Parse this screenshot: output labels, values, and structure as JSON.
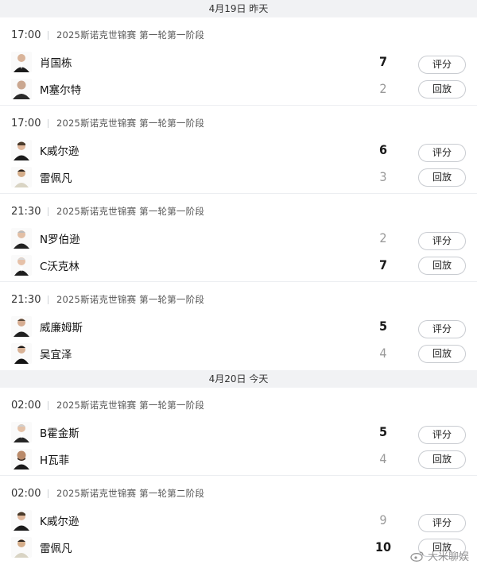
{
  "days": [
    {
      "date_label": "4月19日 昨天",
      "matches": [
        {
          "time": "17:00",
          "name": "2025斯诺克世锦赛 第一轮第一阶段",
          "p1": {
            "name": "肖国栋",
            "score": "7",
            "win": true
          },
          "p2": {
            "name": "M塞尔特",
            "score": "2",
            "win": false
          },
          "btn1": "评分",
          "btn2": "回放"
        },
        {
          "time": "17:00",
          "name": "2025斯诺克世锦赛 第一轮第一阶段",
          "p1": {
            "name": "K威尔逊",
            "score": "6",
            "win": true
          },
          "p2": {
            "name": "雷佩凡",
            "score": "3",
            "win": false
          },
          "btn1": "评分",
          "btn2": "回放"
        },
        {
          "time": "21:30",
          "name": "2025斯诺克世锦赛 第一轮第一阶段",
          "p1": {
            "name": "N罗伯逊",
            "score": "2",
            "win": false
          },
          "p2": {
            "name": "C沃克林",
            "score": "7",
            "win": true
          },
          "btn1": "评分",
          "btn2": "回放"
        },
        {
          "time": "21:30",
          "name": "2025斯诺克世锦赛 第一轮第一阶段",
          "p1": {
            "name": "威廉姆斯",
            "score": "5",
            "win": true
          },
          "p2": {
            "name": "吴宜泽",
            "score": "4",
            "win": false
          },
          "btn1": "评分",
          "btn2": "回放"
        }
      ]
    },
    {
      "date_label": "4月20日 今天",
      "matches": [
        {
          "time": "02:00",
          "name": "2025斯诺克世锦赛 第一轮第一阶段",
          "p1": {
            "name": "B霍金斯",
            "score": "5",
            "win": true
          },
          "p2": {
            "name": "H瓦菲",
            "score": "4",
            "win": false
          },
          "btn1": "评分",
          "btn2": "回放"
        },
        {
          "time": "02:00",
          "name": "2025斯诺克世锦赛 第一轮第二阶段",
          "p1": {
            "name": "K威尔逊",
            "score": "9",
            "win": false
          },
          "p2": {
            "name": "雷佩凡",
            "score": "10",
            "win": true
          },
          "btn1": "评分",
          "btn2": "回放"
        }
      ]
    }
  ],
  "watermark": "大米聊娱",
  "colors": {
    "win": "#1a1a1a",
    "lose": "#9a9a9a",
    "header_bg": "#f1f2f4"
  }
}
